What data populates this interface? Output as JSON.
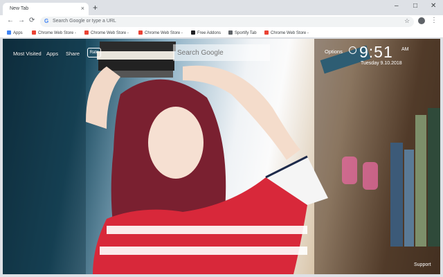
{
  "tab": {
    "title": "New Tab",
    "close": "×"
  },
  "window": {
    "new_tab": "+",
    "minimize": "–",
    "maximize": "□",
    "close": "✕"
  },
  "toolbar": {
    "back": "←",
    "forward": "→",
    "reload": "⟳",
    "omnibox_placeholder": "Search Google or type a URL",
    "google_g": "G",
    "star": "☆",
    "menu": "⋮"
  },
  "bookmarks": [
    {
      "label": "Apps",
      "icon": "apps-grid-icon",
      "color": "#4285f4"
    },
    {
      "label": "Chrome Web Store -",
      "icon": "webstore-icon",
      "color": "#ea4335"
    },
    {
      "label": "Chrome Web Store -",
      "icon": "webstore-icon",
      "color": "#ea4335"
    },
    {
      "label": "Chrome Web Store -",
      "icon": "webstore-icon",
      "color": "#ea4335"
    },
    {
      "label": "Free Addons",
      "icon": "addons-icon",
      "color": "#202124"
    },
    {
      "label": "Sportify Tab",
      "icon": "sportify-icon",
      "color": "#5f6368"
    },
    {
      "label": "Chrome Web Store -",
      "icon": "webstore-icon",
      "color": "#ea4335"
    }
  ],
  "newtab": {
    "links": [
      "Most Visited",
      "Apps",
      "Share"
    ],
    "rate": "Rate",
    "search_placeholder": "Search Google",
    "options": "Options",
    "time": "9:51",
    "ampm": "AM",
    "date": "Tuesday  9.10.2018",
    "support": "Support"
  }
}
